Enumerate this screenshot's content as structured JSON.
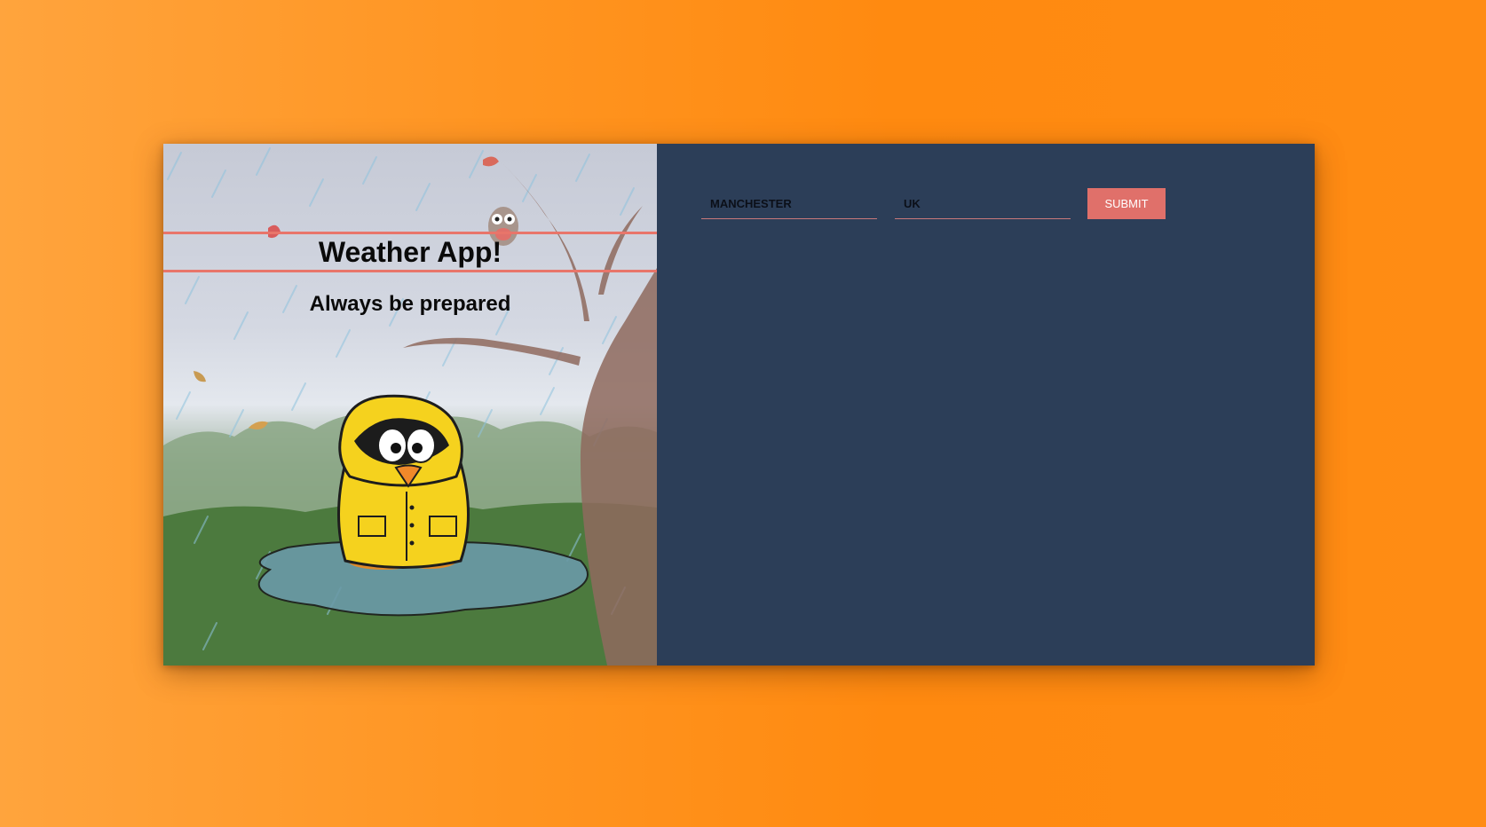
{
  "app": {
    "title": "Weather App!",
    "tagline": "Always be prepared"
  },
  "form": {
    "city_value": "MANCHESTER",
    "country_value": "UK",
    "submit_label": "SUBMIT"
  },
  "colors": {
    "background_orange": "#ff8c14",
    "panel_navy": "#2c3e58",
    "accent_coral": "#e0706a",
    "raincoat_yellow": "#f5d21e"
  },
  "illustration": {
    "icon": "penguin-in-raincoat-illustration"
  }
}
